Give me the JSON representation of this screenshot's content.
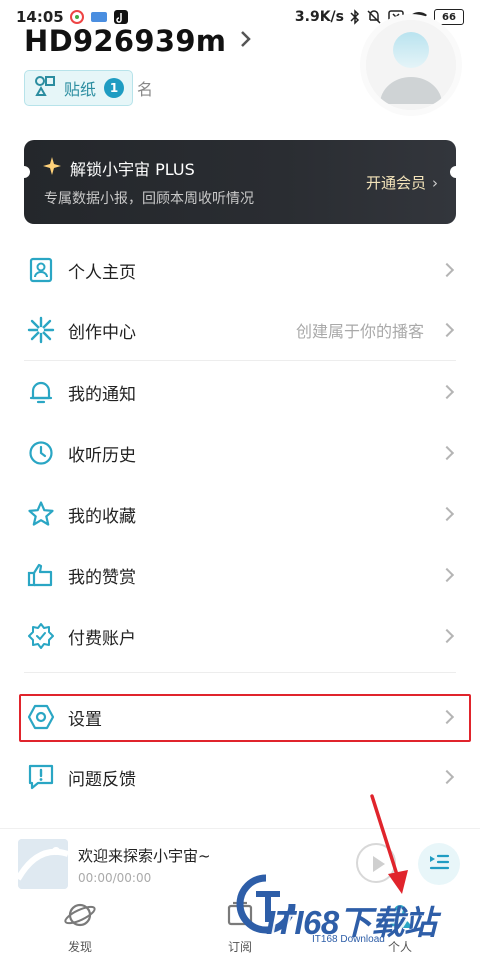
{
  "status_bar": {
    "time": "14:05",
    "net_speed": "3.9K/s",
    "battery": "66"
  },
  "profile": {
    "username": "HD926939m",
    "sticker_label": "贴纸",
    "sticker_count": "1",
    "signature_fragment": "名"
  },
  "plus_banner": {
    "title": "解锁小宇宙 PLUS",
    "subtitle": "专属数据小报，回顾本周收听情况",
    "cta": "开通会员"
  },
  "menu": {
    "items": [
      {
        "label": "个人主页",
        "hint": "",
        "icon": "profile-card-icon"
      },
      {
        "label": "创作中心",
        "hint": "创建属于你的播客",
        "icon": "sparkle-icon"
      },
      {
        "label": "我的通知",
        "hint": "",
        "icon": "bell-icon"
      },
      {
        "label": "收听历史",
        "hint": "",
        "icon": "clock-icon"
      },
      {
        "label": "我的收藏",
        "hint": "",
        "icon": "star-icon"
      },
      {
        "label": "我的赞赏",
        "hint": "",
        "icon": "thumbs-up-icon"
      },
      {
        "label": "付费账户",
        "hint": "",
        "icon": "badge-icon"
      },
      {
        "label": "设置",
        "hint": "",
        "icon": "hexagon-gear-icon"
      },
      {
        "label": "问题反馈",
        "hint": "",
        "icon": "feedback-icon"
      }
    ]
  },
  "player": {
    "title": "欢迎来探索小宇宙~",
    "time": "00:00/00:00"
  },
  "tabs": [
    {
      "label": "发现",
      "icon": "planet-icon"
    },
    {
      "label": "订阅",
      "icon": "subscribe-icon"
    },
    {
      "label": "个人",
      "icon": "person-icon"
    }
  ],
  "watermark": {
    "main": "ITI68下载站",
    "sub": "IT168 Download"
  },
  "colors": {
    "accent": "#1f9cc2",
    "icon": "#2aa6c4",
    "highlight": "#e0242c",
    "banner_bg": "#2a2d32",
    "banner_cta": "#f2e2b8"
  }
}
